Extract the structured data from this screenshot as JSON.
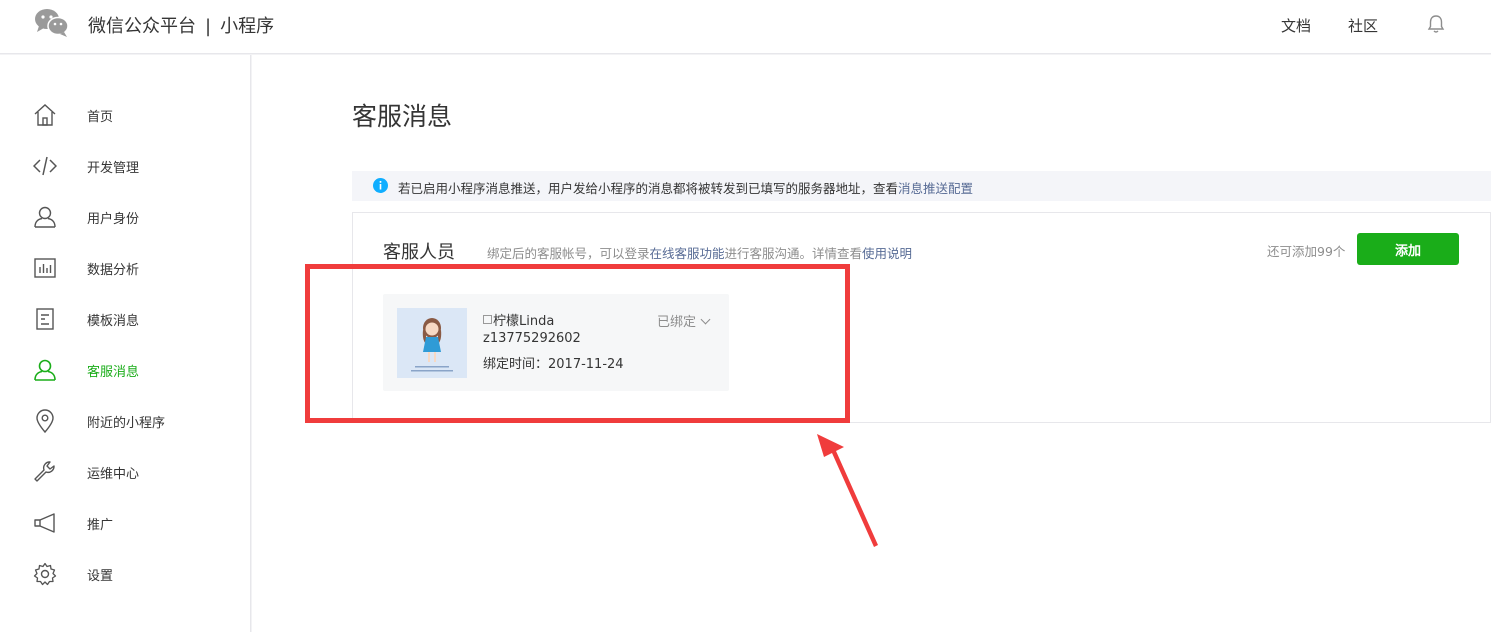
{
  "header": {
    "brand_name": "微信公众平台",
    "separator": "|",
    "product": "小程序",
    "links": {
      "docs": "文档",
      "community": "社区"
    }
  },
  "sidebar": {
    "items": [
      {
        "label": "首页",
        "icon": "home-icon"
      },
      {
        "label": "开发管理",
        "icon": "code-icon"
      },
      {
        "label": "用户身份",
        "icon": "user-icon"
      },
      {
        "label": "数据分析",
        "icon": "chart-icon"
      },
      {
        "label": "模板消息",
        "icon": "template-icon"
      },
      {
        "label": "客服消息",
        "icon": "customer-service-icon",
        "active": true
      },
      {
        "label": "附近的小程序",
        "icon": "location-icon"
      },
      {
        "label": "运维中心",
        "icon": "wrench-icon"
      },
      {
        "label": "推广",
        "icon": "megaphone-icon"
      },
      {
        "label": "设置",
        "icon": "gear-icon"
      }
    ]
  },
  "main": {
    "title": "客服消息",
    "notice": {
      "text": "若已启用小程序消息推送，用户发给小程序的消息都将被转发到已填写的服务器地址，查看",
      "link": "消息推送配置"
    },
    "panel": {
      "title": "客服人员",
      "desc_prefix": "绑定后的客服帐号，可以登录",
      "desc_link1": "在线客服功能",
      "desc_middle": "进行客服沟通。详情查看",
      "desc_link2": "使用说明",
      "quota": "还可添加99个",
      "add_label": "添加"
    },
    "staff": [
      {
        "name": "柠檬Linda",
        "account": "z13775292602",
        "bound_label": "绑定时间：",
        "bound_date": "2017-11-24",
        "status": "已绑定"
      }
    ]
  },
  "colors": {
    "accent": "#1aad19",
    "link": "#576b95",
    "info": "#10aeff",
    "annotation": "#f03c3c"
  }
}
